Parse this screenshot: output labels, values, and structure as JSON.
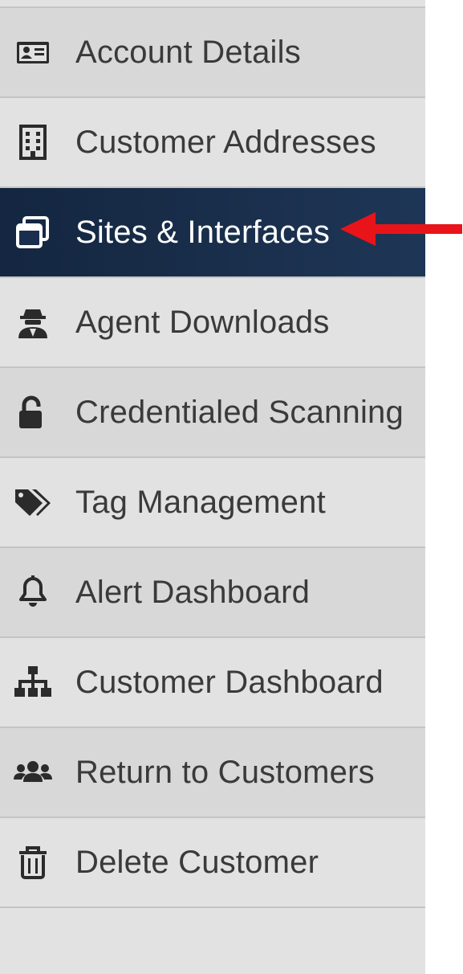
{
  "sidebar": {
    "items": [
      {
        "label": "Account Details",
        "icon": "id-card-icon",
        "active": false
      },
      {
        "label": "Customer Addresses",
        "icon": "building-icon",
        "active": false
      },
      {
        "label": "Sites & Interfaces",
        "icon": "window-restore-icon",
        "active": true
      },
      {
        "label": "Agent Downloads",
        "icon": "user-secret-icon",
        "active": false
      },
      {
        "label": "Credentialed Scanning",
        "icon": "unlock-icon",
        "active": false
      },
      {
        "label": "Tag Management",
        "icon": "tags-icon",
        "active": false
      },
      {
        "label": "Alert Dashboard",
        "icon": "bell-icon",
        "active": false
      },
      {
        "label": "Customer Dashboard",
        "icon": "sitemap-icon",
        "active": false
      },
      {
        "label": "Return to Customers",
        "icon": "users-icon",
        "active": false
      },
      {
        "label": "Delete Customer",
        "icon": "trash-icon",
        "active": false
      }
    ]
  },
  "colors": {
    "item_bg": "#e2e2e2",
    "item_alt_bg": "#d8d8d8",
    "active_bg": "#1a2f4d",
    "text": "#3a3a3a",
    "active_text": "#ffffff",
    "divider": "#c4c4c4",
    "annotation_arrow": "#e8141a"
  },
  "annotation": {
    "type": "arrow",
    "points_to": "Sites & Interfaces",
    "icon": "red-arrow-icon"
  }
}
